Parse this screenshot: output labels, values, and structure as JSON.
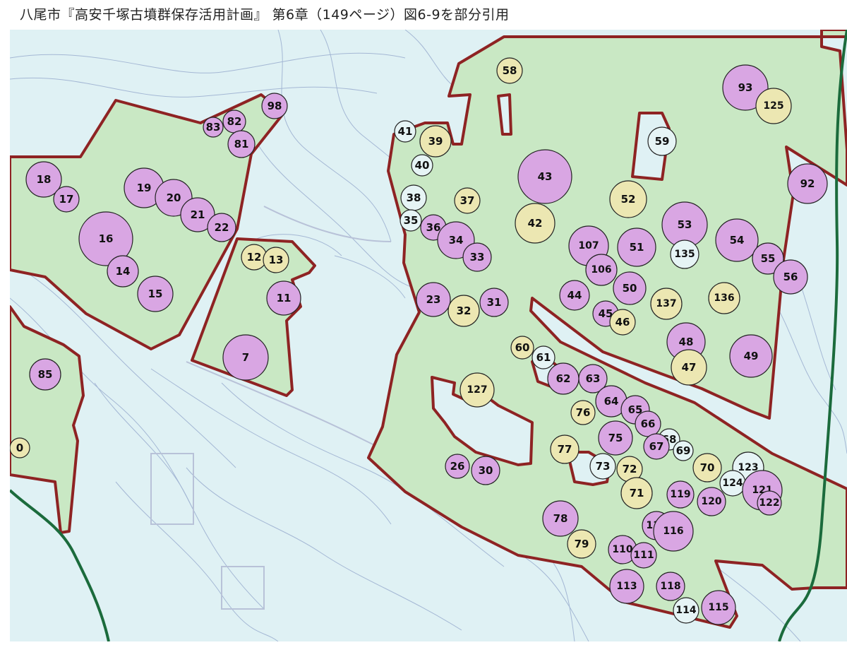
{
  "caption": "八尾市『高安千塚古墳群保存活用計画』 第6章（149ページ）図6-9を部分引用",
  "colors": {
    "background": "#dff1f4",
    "zone_fill": "#c9e8c4",
    "zone_border": "#8e2323",
    "tomb_purple": "#d9a6e3",
    "tomb_beige": "#ece7b2",
    "contour": "#9aaecf",
    "river": "#1b6b3c"
  },
  "tombs": [
    {
      "id": "18",
      "c": "p"
    },
    {
      "id": "17",
      "c": "p"
    },
    {
      "id": "19",
      "c": "p"
    },
    {
      "id": "20",
      "c": "p"
    },
    {
      "id": "21",
      "c": "p"
    },
    {
      "id": "22",
      "c": "p"
    },
    {
      "id": "16",
      "c": "p"
    },
    {
      "id": "14",
      "c": "p"
    },
    {
      "id": "15",
      "c": "p"
    },
    {
      "id": "83",
      "c": "p"
    },
    {
      "id": "82",
      "c": "p"
    },
    {
      "id": "81",
      "c": "p"
    },
    {
      "id": "98",
      "c": "p"
    },
    {
      "id": "12",
      "c": "b"
    },
    {
      "id": "13",
      "c": "b"
    },
    {
      "id": "11",
      "c": "p"
    },
    {
      "id": "7",
      "c": "p"
    },
    {
      "id": "85",
      "c": "p"
    },
    {
      "id": "58",
      "c": "b"
    },
    {
      "id": "41",
      "c": "w"
    },
    {
      "id": "39",
      "c": "b"
    },
    {
      "id": "40",
      "c": "w"
    },
    {
      "id": "38",
      "c": "w"
    },
    {
      "id": "37",
      "c": "b"
    },
    {
      "id": "35",
      "c": "w"
    },
    {
      "id": "36",
      "c": "p"
    },
    {
      "id": "34",
      "c": "p"
    },
    {
      "id": "33",
      "c": "p"
    },
    {
      "id": "43",
      "c": "p"
    },
    {
      "id": "42",
      "c": "b"
    },
    {
      "id": "23",
      "c": "p"
    },
    {
      "id": "32",
      "c": "b"
    },
    {
      "id": "31",
      "c": "p"
    },
    {
      "id": "93",
      "c": "p"
    },
    {
      "id": "125",
      "c": "b"
    },
    {
      "id": "59",
      "c": "w"
    },
    {
      "id": "92",
      "c": "p"
    },
    {
      "id": "52",
      "c": "b"
    },
    {
      "id": "53",
      "c": "p"
    },
    {
      "id": "54",
      "c": "p"
    },
    {
      "id": "55",
      "c": "p"
    },
    {
      "id": "56",
      "c": "p"
    },
    {
      "id": "107",
      "c": "p"
    },
    {
      "id": "51",
      "c": "p"
    },
    {
      "id": "135",
      "c": "w"
    },
    {
      "id": "106",
      "c": "p"
    },
    {
      "id": "44",
      "c": "p"
    },
    {
      "id": "50",
      "c": "p"
    },
    {
      "id": "137",
      "c": "b"
    },
    {
      "id": "136",
      "c": "b"
    },
    {
      "id": "45",
      "c": "p"
    },
    {
      "id": "46",
      "c": "b"
    },
    {
      "id": "48",
      "c": "p"
    },
    {
      "id": "47",
      "c": "b"
    },
    {
      "id": "49",
      "c": "p"
    },
    {
      "id": "60",
      "c": "b"
    },
    {
      "id": "61",
      "c": "w"
    },
    {
      "id": "62",
      "c": "p"
    },
    {
      "id": "63",
      "c": "p"
    },
    {
      "id": "127",
      "c": "b"
    },
    {
      "id": "64",
      "c": "p"
    },
    {
      "id": "76",
      "c": "b"
    },
    {
      "id": "65",
      "c": "p"
    },
    {
      "id": "66",
      "c": "p"
    },
    {
      "id": "75",
      "c": "p"
    },
    {
      "id": "68",
      "c": "w"
    },
    {
      "id": "67",
      "c": "p"
    },
    {
      "id": "69",
      "c": "w"
    },
    {
      "id": "77",
      "c": "b"
    },
    {
      "id": "73",
      "c": "w"
    },
    {
      "id": "72",
      "c": "b"
    },
    {
      "id": "26",
      "c": "p"
    },
    {
      "id": "30",
      "c": "p"
    },
    {
      "id": "70",
      "c": "b"
    },
    {
      "id": "123",
      "c": "w"
    },
    {
      "id": "124",
      "c": "w"
    },
    {
      "id": "121",
      "c": "p"
    },
    {
      "id": "122",
      "c": "p"
    },
    {
      "id": "71",
      "c": "b"
    },
    {
      "id": "119",
      "c": "p"
    },
    {
      "id": "120",
      "c": "p"
    },
    {
      "id": "78",
      "c": "p"
    },
    {
      "id": "117",
      "c": "p"
    },
    {
      "id": "116",
      "c": "p"
    },
    {
      "id": "79",
      "c": "b"
    },
    {
      "id": "110",
      "c": "p"
    },
    {
      "id": "111",
      "c": "p"
    },
    {
      "id": "113",
      "c": "p"
    },
    {
      "id": "118",
      "c": "p"
    },
    {
      "id": "114",
      "c": "w"
    },
    {
      "id": "115",
      "c": "p"
    },
    {
      "id": "0",
      "c": "b"
    }
  ]
}
